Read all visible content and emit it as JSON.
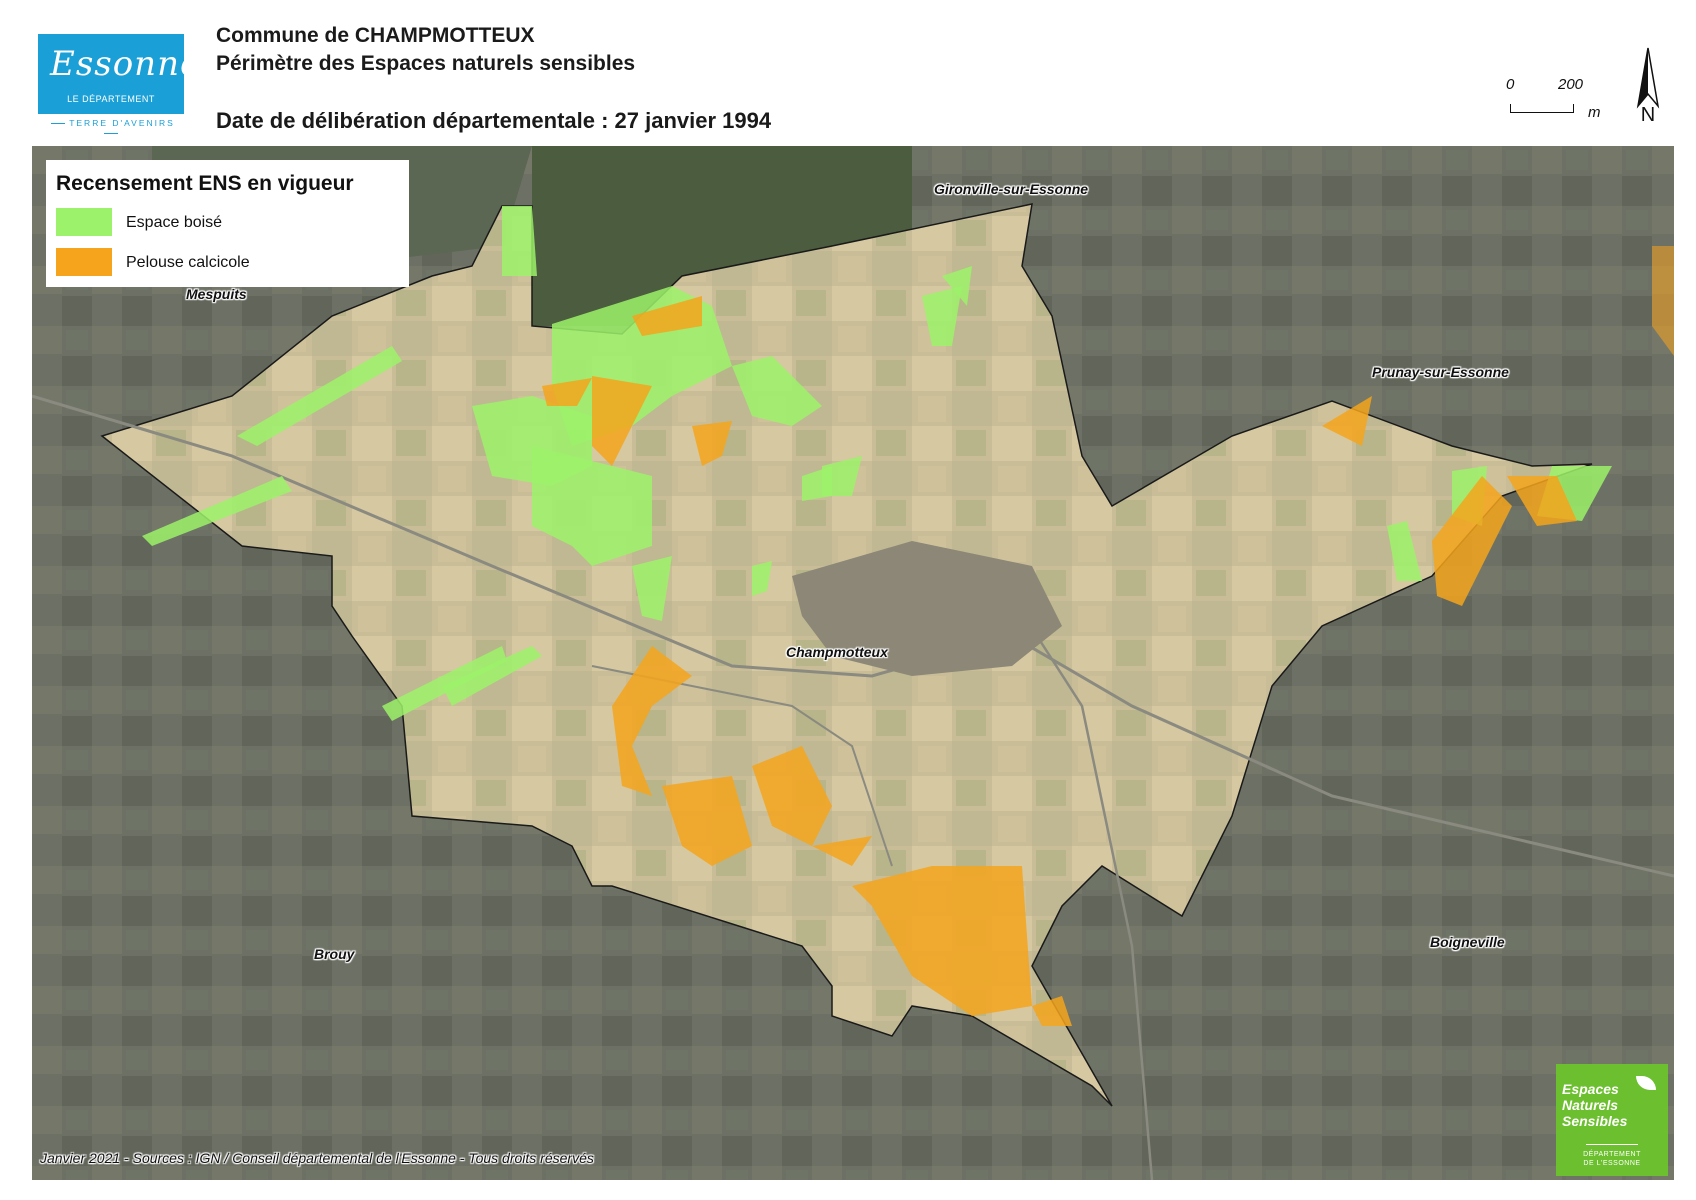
{
  "header": {
    "commune": "Commune de CHAMPMOTTEUX",
    "subtitle": "Périmètre des Espaces naturels sensibles",
    "date_line": "Date de délibération départementale : 27 janvier 1994"
  },
  "logo": {
    "script": "Essonne",
    "department": "LE DÉPARTEMENT",
    "tagline": "TERRE D'AVENIRS",
    "color": "#1a9fd6"
  },
  "scale_bar": {
    "start": "0",
    "end": "200",
    "unit": "m"
  },
  "north_arrow": {
    "letter": "N",
    "icon": "north-arrow-icon"
  },
  "legend": {
    "title": "Recensement ENS en vigueur",
    "items": [
      {
        "label": "Espace boisé",
        "color": "#9cf26a"
      },
      {
        "label": "Pelouse calcicole",
        "color": "#f5a41c"
      }
    ]
  },
  "places": {
    "gironville": "Gironville-sur-Essonne",
    "mespuits": "Mespuits",
    "prunay": "Prunay-sur-Essonne",
    "champmotteux": "Champmotteux",
    "brouy": "Brouy",
    "boigneville": "Boigneville"
  },
  "source": "Janvier 2021 - Sources : IGN / Conseil départemental de l'Essonne - Tous droits réservés",
  "ens_logo": {
    "line1": "Espaces",
    "line2": "Naturels",
    "line3": "Sensibles",
    "dept1": "DÉPARTEMENT",
    "dept2": "DE L'ESSONNE",
    "color": "#6cbf2e"
  }
}
